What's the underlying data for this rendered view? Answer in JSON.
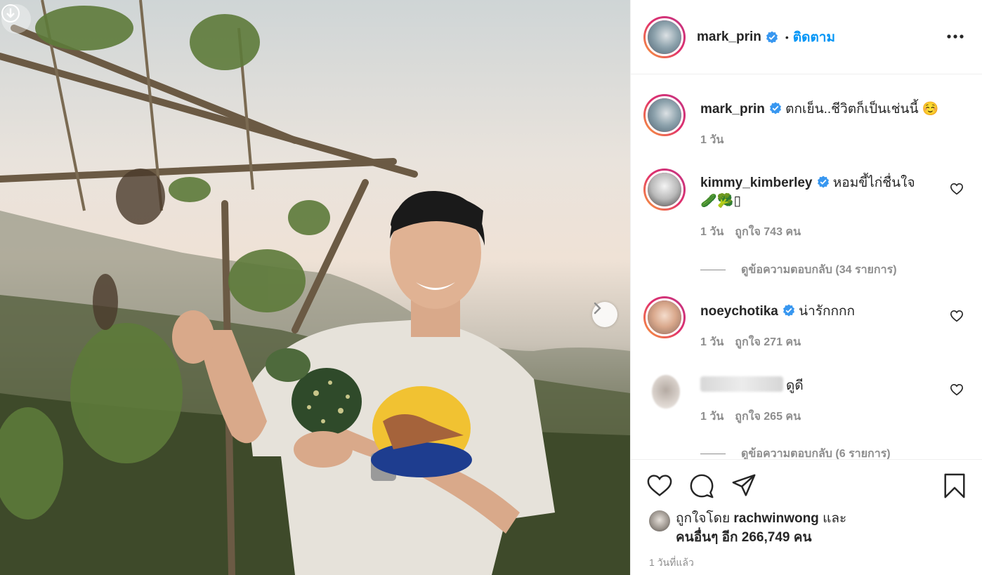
{
  "post": {
    "author": "mark_prin",
    "follow_label": "ติดตาม",
    "caption": "ตกเย็น..ชีวิตก็เป็นเช่นนี้ ☺️",
    "caption_time": "1 วัน"
  },
  "comments": [
    {
      "user": "kimmy_kimberley",
      "verified": true,
      "text": "หอมขี้ไก่ชื่นใจ",
      "emoji": "🥒🥦▯",
      "time": "1 วัน",
      "likes": "ถูกใจ 743 คน",
      "replies": "ดูข้อความตอบกลับ (34 รายการ)"
    },
    {
      "user": "noeychotika",
      "verified": true,
      "text": "น่ารักกกก",
      "time": "1 วัน",
      "likes": "ถูกใจ 271 คน"
    },
    {
      "user": "",
      "blurred": true,
      "text": "ดูดี",
      "time": "1 วัน",
      "likes": "ถูกใจ 265 คน",
      "replies": "ดูข้อความตอบกลับ (6 รายการ)"
    }
  ],
  "liked_by": {
    "prefix": "ถูกใจโดย",
    "user": "rachwinwong",
    "and": "และ",
    "others": "คนอื่นๆ อีก 266,749 คน"
  },
  "timestamp": "1 วันที่แล้ว",
  "colors": {
    "accent": "#0095f6",
    "verified": "#3897f0",
    "muted": "#8e8e8e"
  },
  "icons": [
    "download-icon",
    "chevron-right-icon",
    "verified-icon",
    "more-icon",
    "heart-icon",
    "comment-icon",
    "share-icon",
    "bookmark-icon"
  ]
}
